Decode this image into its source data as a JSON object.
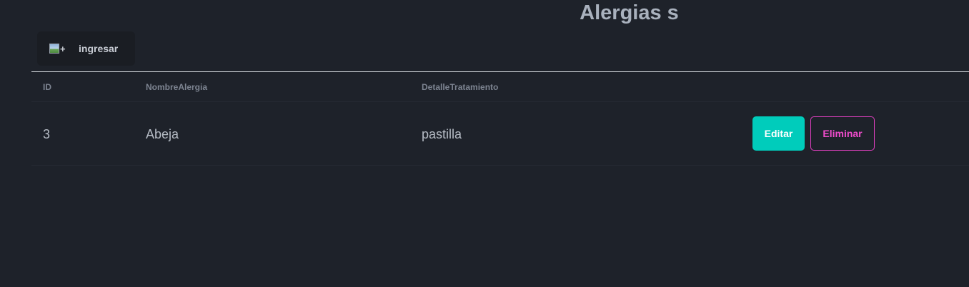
{
  "page": {
    "title": "Alergias s"
  },
  "add_button": {
    "icon_alt": "+",
    "label": "ingresar"
  },
  "table": {
    "columns": [
      "ID",
      "NombreAlergia",
      "DetalleTratamiento"
    ],
    "rows": [
      {
        "id": "3",
        "nombre_alergia": "Abeja",
        "detalle_tratamiento": "pastilla",
        "edit_label": "Editar",
        "delete_label": "Eliminar"
      }
    ]
  },
  "colors": {
    "background": "#1e222a",
    "edit_button": "#00ccbb",
    "delete_accent": "#f04ccc"
  }
}
